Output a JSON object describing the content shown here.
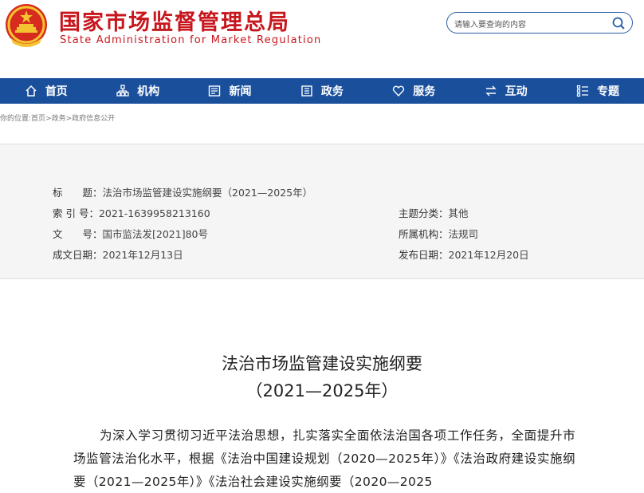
{
  "header": {
    "title": "国家市场监督管理总局",
    "subtitle": "State Administration for Market Regulation",
    "emblem_icon": "national-emblem-icon"
  },
  "search": {
    "placeholder": "请输入要查询的内容",
    "icon": "search-icon"
  },
  "nav": {
    "items": [
      {
        "label": "首页",
        "icon": "home-icon"
      },
      {
        "label": "机构",
        "icon": "org-icon"
      },
      {
        "label": "新闻",
        "icon": "news-icon"
      },
      {
        "label": "政务",
        "icon": "affairs-icon"
      },
      {
        "label": "服务",
        "icon": "heart-icon"
      },
      {
        "label": "互动",
        "icon": "exchange-icon"
      },
      {
        "label": "专题",
        "icon": "list-icon"
      }
    ]
  },
  "breadcrumb": {
    "prefix": "你的位置:",
    "items": [
      "首页",
      "政务",
      "政府信息公开"
    ],
    "separator": ">"
  },
  "info": {
    "title_label": "标　　题：",
    "title_value": "法治市场监管建设实施纲要（2021—2025年）",
    "index_label": "索 引 号：",
    "index_value": "2021-1639958213160",
    "doc_label": "文　　号：",
    "doc_value": "国市监法发[2021]80号",
    "date_label": "成文日期：",
    "date_value": "2021年12月13日",
    "category_label": "主题分类：",
    "category_value": "其他",
    "org_label": "所属机构：",
    "org_value": "法规司",
    "publish_label": "发布日期：",
    "publish_value": "2021年12月20日"
  },
  "article": {
    "title_line1": "法治市场监管建设实施纲要",
    "title_line2": "（2021—2025年）",
    "body": "为深入学习贯彻习近平法治思想，扎实落实全面依法治国各项工作任务，全面提升市场监管法治化水平，根据《法治中国建设规划（2020—2025年）》《法治政府建设实施纲要（2021—2025年）》《法治社会建设实施纲要（2020—2025"
  },
  "colors": {
    "brand_red": "#c8161d",
    "nav_blue": "#1a4f9c",
    "info_bg": "#f5f5f5"
  }
}
